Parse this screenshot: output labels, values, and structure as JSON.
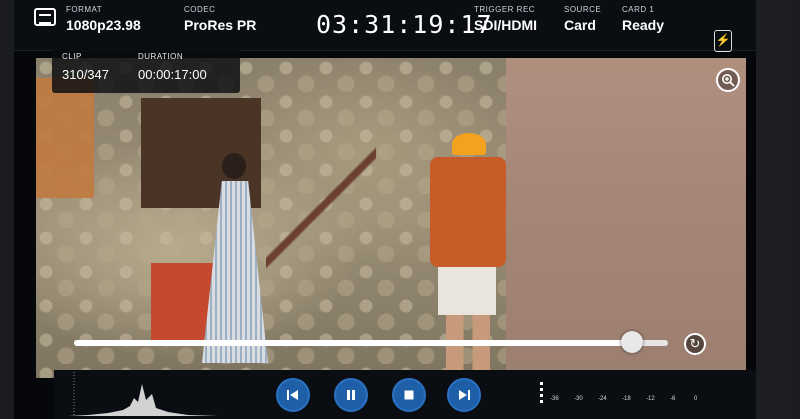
{
  "status_bar": {
    "format": {
      "label": "FORMAT",
      "value": "1080p23.98"
    },
    "codec": {
      "label": "CODEC",
      "value": "ProRes PR"
    },
    "timecode": "03:31:19:17",
    "trigger_rec": {
      "label": "TRIGGER REC",
      "value": "SDI/HDMI"
    },
    "source": {
      "label": "SOURCE",
      "value": "Card"
    },
    "card": {
      "label": "CARD 1",
      "value": "Ready"
    }
  },
  "clip_info": {
    "clip": {
      "label": "CLIP",
      "value": "310/347"
    },
    "duration": {
      "label": "DURATION",
      "value": "00:00:17:00"
    }
  },
  "playback": {
    "progress_fraction": 0.94,
    "state": "paused"
  },
  "audio_meter": {
    "ticks": [
      "-36",
      "-30",
      "-24",
      "-18",
      "-12",
      "-6",
      "0"
    ]
  },
  "icons": {
    "menu": "menu-icon",
    "power": "bolt-icon",
    "zoom": "zoom-in-icon",
    "loop": "loop-icon",
    "skip_back": "skip-back-icon",
    "pause": "pause-icon",
    "stop": "stop-icon",
    "skip_forward": "skip-forward-icon"
  },
  "colors": {
    "transport_button": "#1e5fa8",
    "status_bar_bg": "#0a0d12"
  }
}
